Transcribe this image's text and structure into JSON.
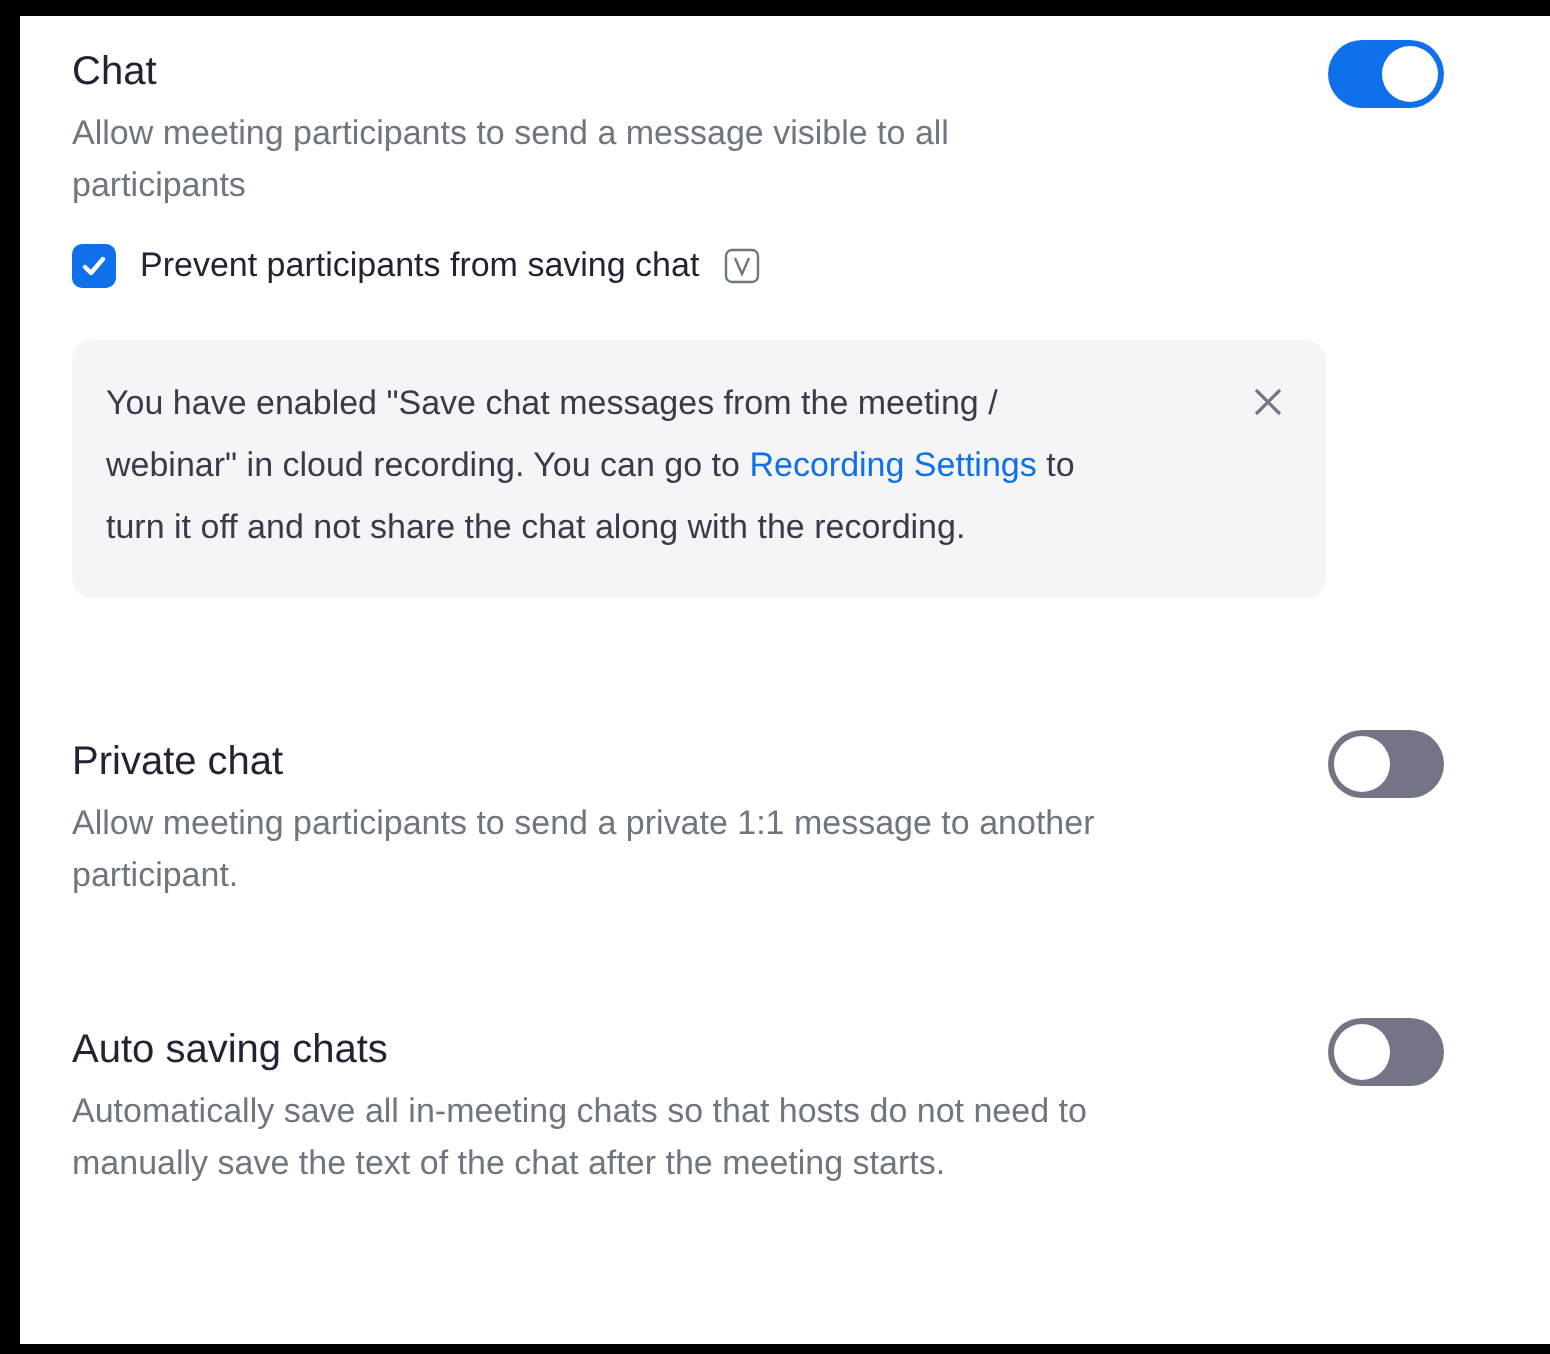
{
  "settings": [
    {
      "title": "Chat",
      "description": "Allow meeting participants to send a message visible to all participants",
      "on": true,
      "option": {
        "label": "Prevent participants from saving chat",
        "checked": true
      },
      "notice": {
        "text_before": "You have enabled \"Save chat messages from the meeting / webinar\" in cloud recording. You can go to",
        "link": "Recording Settings",
        "text_after": "to turn it off and not share the chat along with the recording."
      }
    },
    {
      "title": "Private chat",
      "description": "Allow meeting participants to send a private 1:1 message to another participant.",
      "on": false
    },
    {
      "title": "Auto saving chats",
      "description": "Automatically save all in-meeting chats so that hosts do not need to manually save the text of the chat after the meeting starts.",
      "on": false
    }
  ]
}
